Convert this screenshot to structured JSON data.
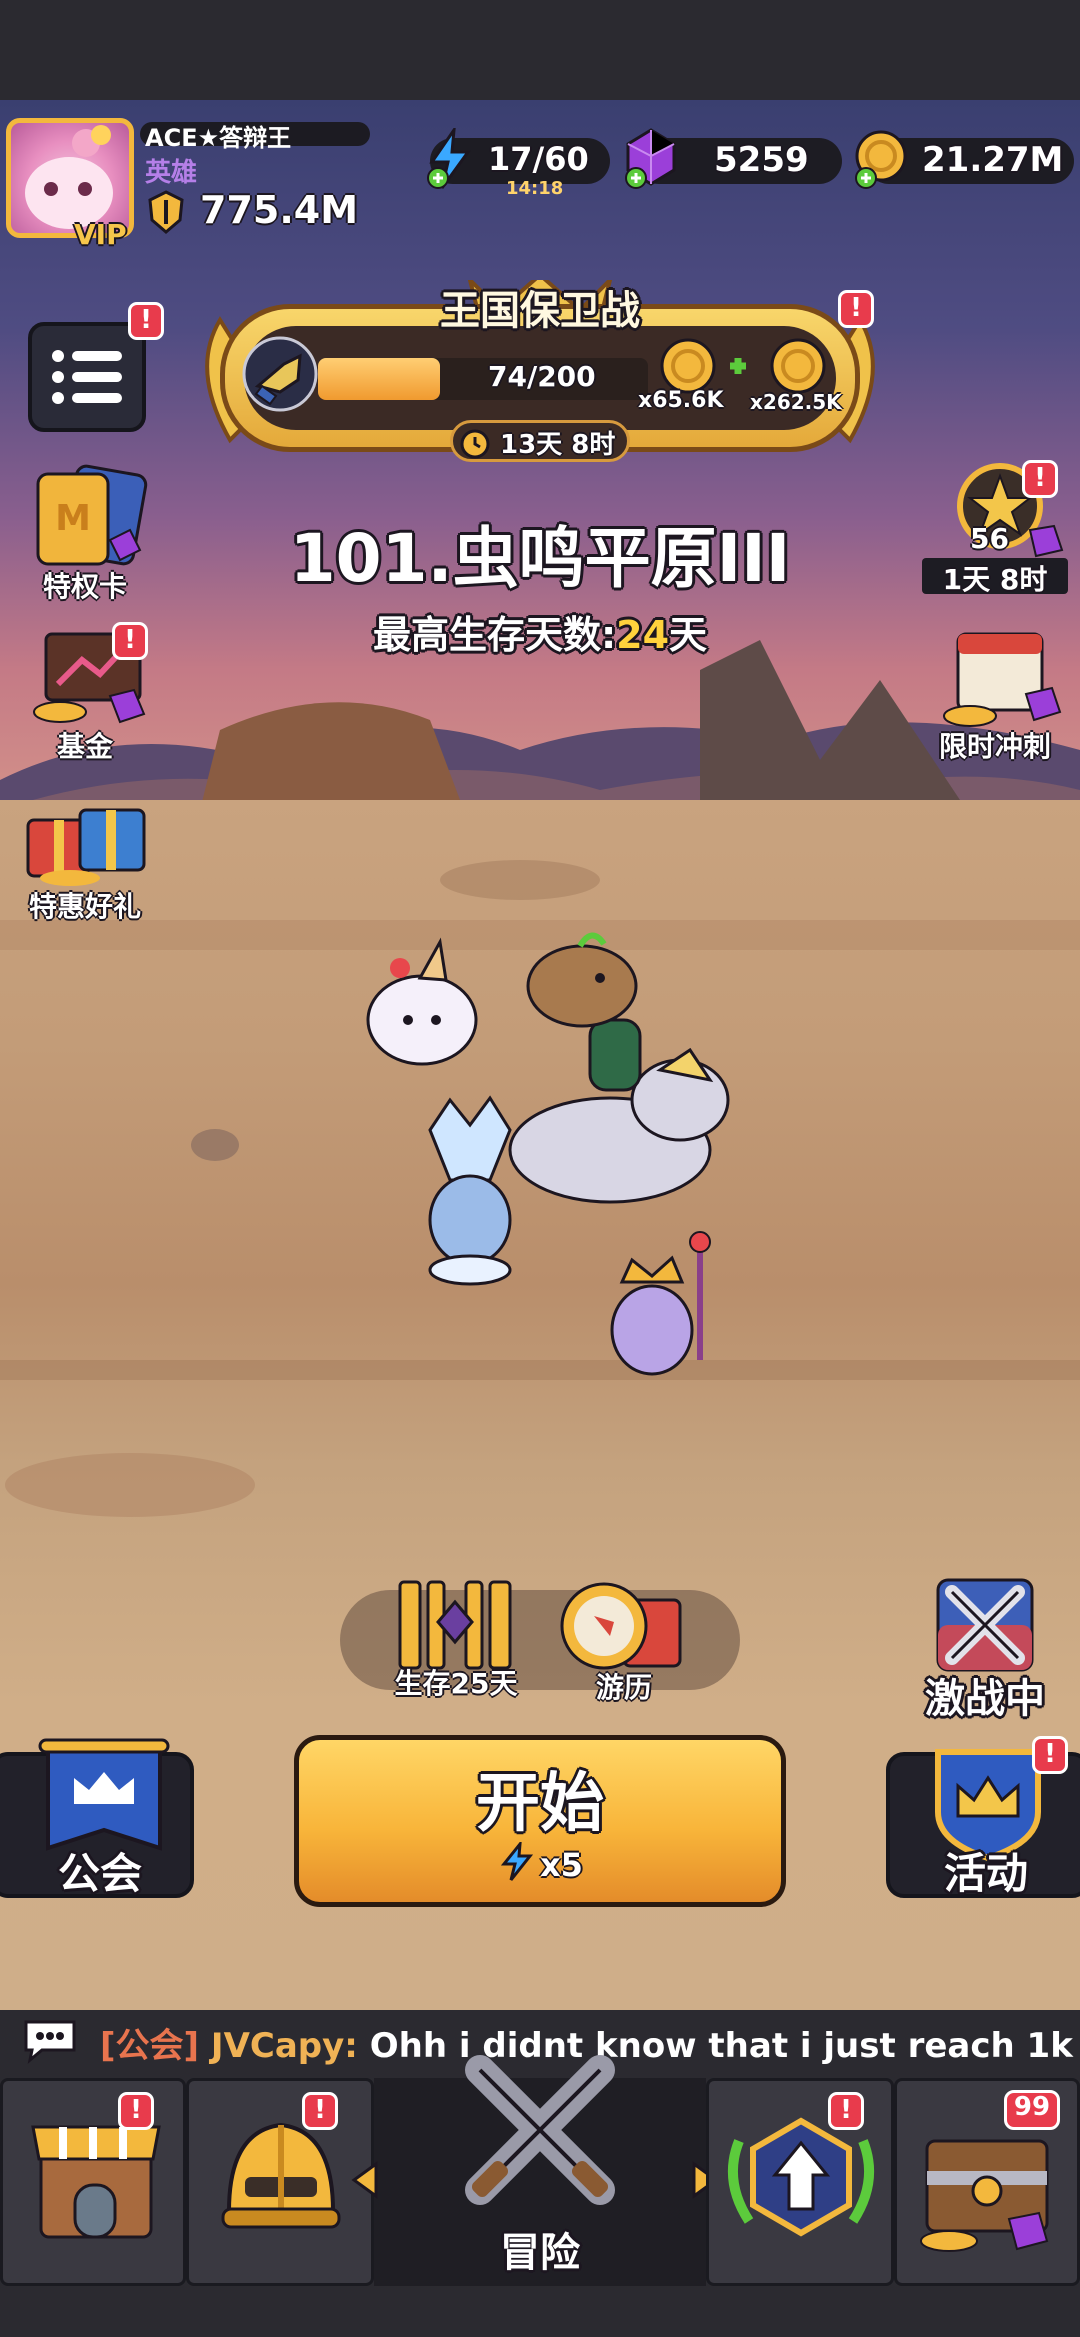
{
  "player": {
    "name": "ACE★答辩王",
    "title": "英雄",
    "vip_label": "VIP",
    "power": "775.4M"
  },
  "resources": {
    "energy": "17/60",
    "energy_timer": "14:18",
    "gems": "5259",
    "gold": "21.27M"
  },
  "kingdom_defense": {
    "title": "王国保卫战",
    "progress_text": "74/200",
    "progress_fraction": 0.37,
    "reward1": "x65.6K",
    "reward2": "x262.5K",
    "timer": "13天 8时"
  },
  "stage": {
    "title": "101.虫鸣平原III",
    "survival_label": "最高生存天数:",
    "survival_value": "24",
    "survival_unit": "天"
  },
  "left_menu": {
    "privilege_card": "特权卡",
    "fund": "基金",
    "special_gift": "特惠好礼"
  },
  "right_menu": {
    "pass_level": "56",
    "pass_timer": "1天 8时",
    "limited_sprint": "限时冲刺",
    "battle_label": "激战中"
  },
  "mid_buttons": {
    "survival_chest": "生存25天",
    "travel": "游历"
  },
  "start": {
    "label": "开始",
    "cost": "x5"
  },
  "side_buttons": {
    "guild": "公会",
    "event": "活动"
  },
  "chat": {
    "channel": "[公会]",
    "user": "JVCapy:",
    "message": "Ohh i didnt know that i just reach 1k"
  },
  "nav": {
    "adventure": "冒险",
    "chest_count": "99"
  },
  "colors": {
    "gold_accent": "#f8b53a",
    "badge_red": "#e83b4c",
    "gem_purple": "#9b3fd9",
    "energy_blue": "#3aa8ff"
  }
}
